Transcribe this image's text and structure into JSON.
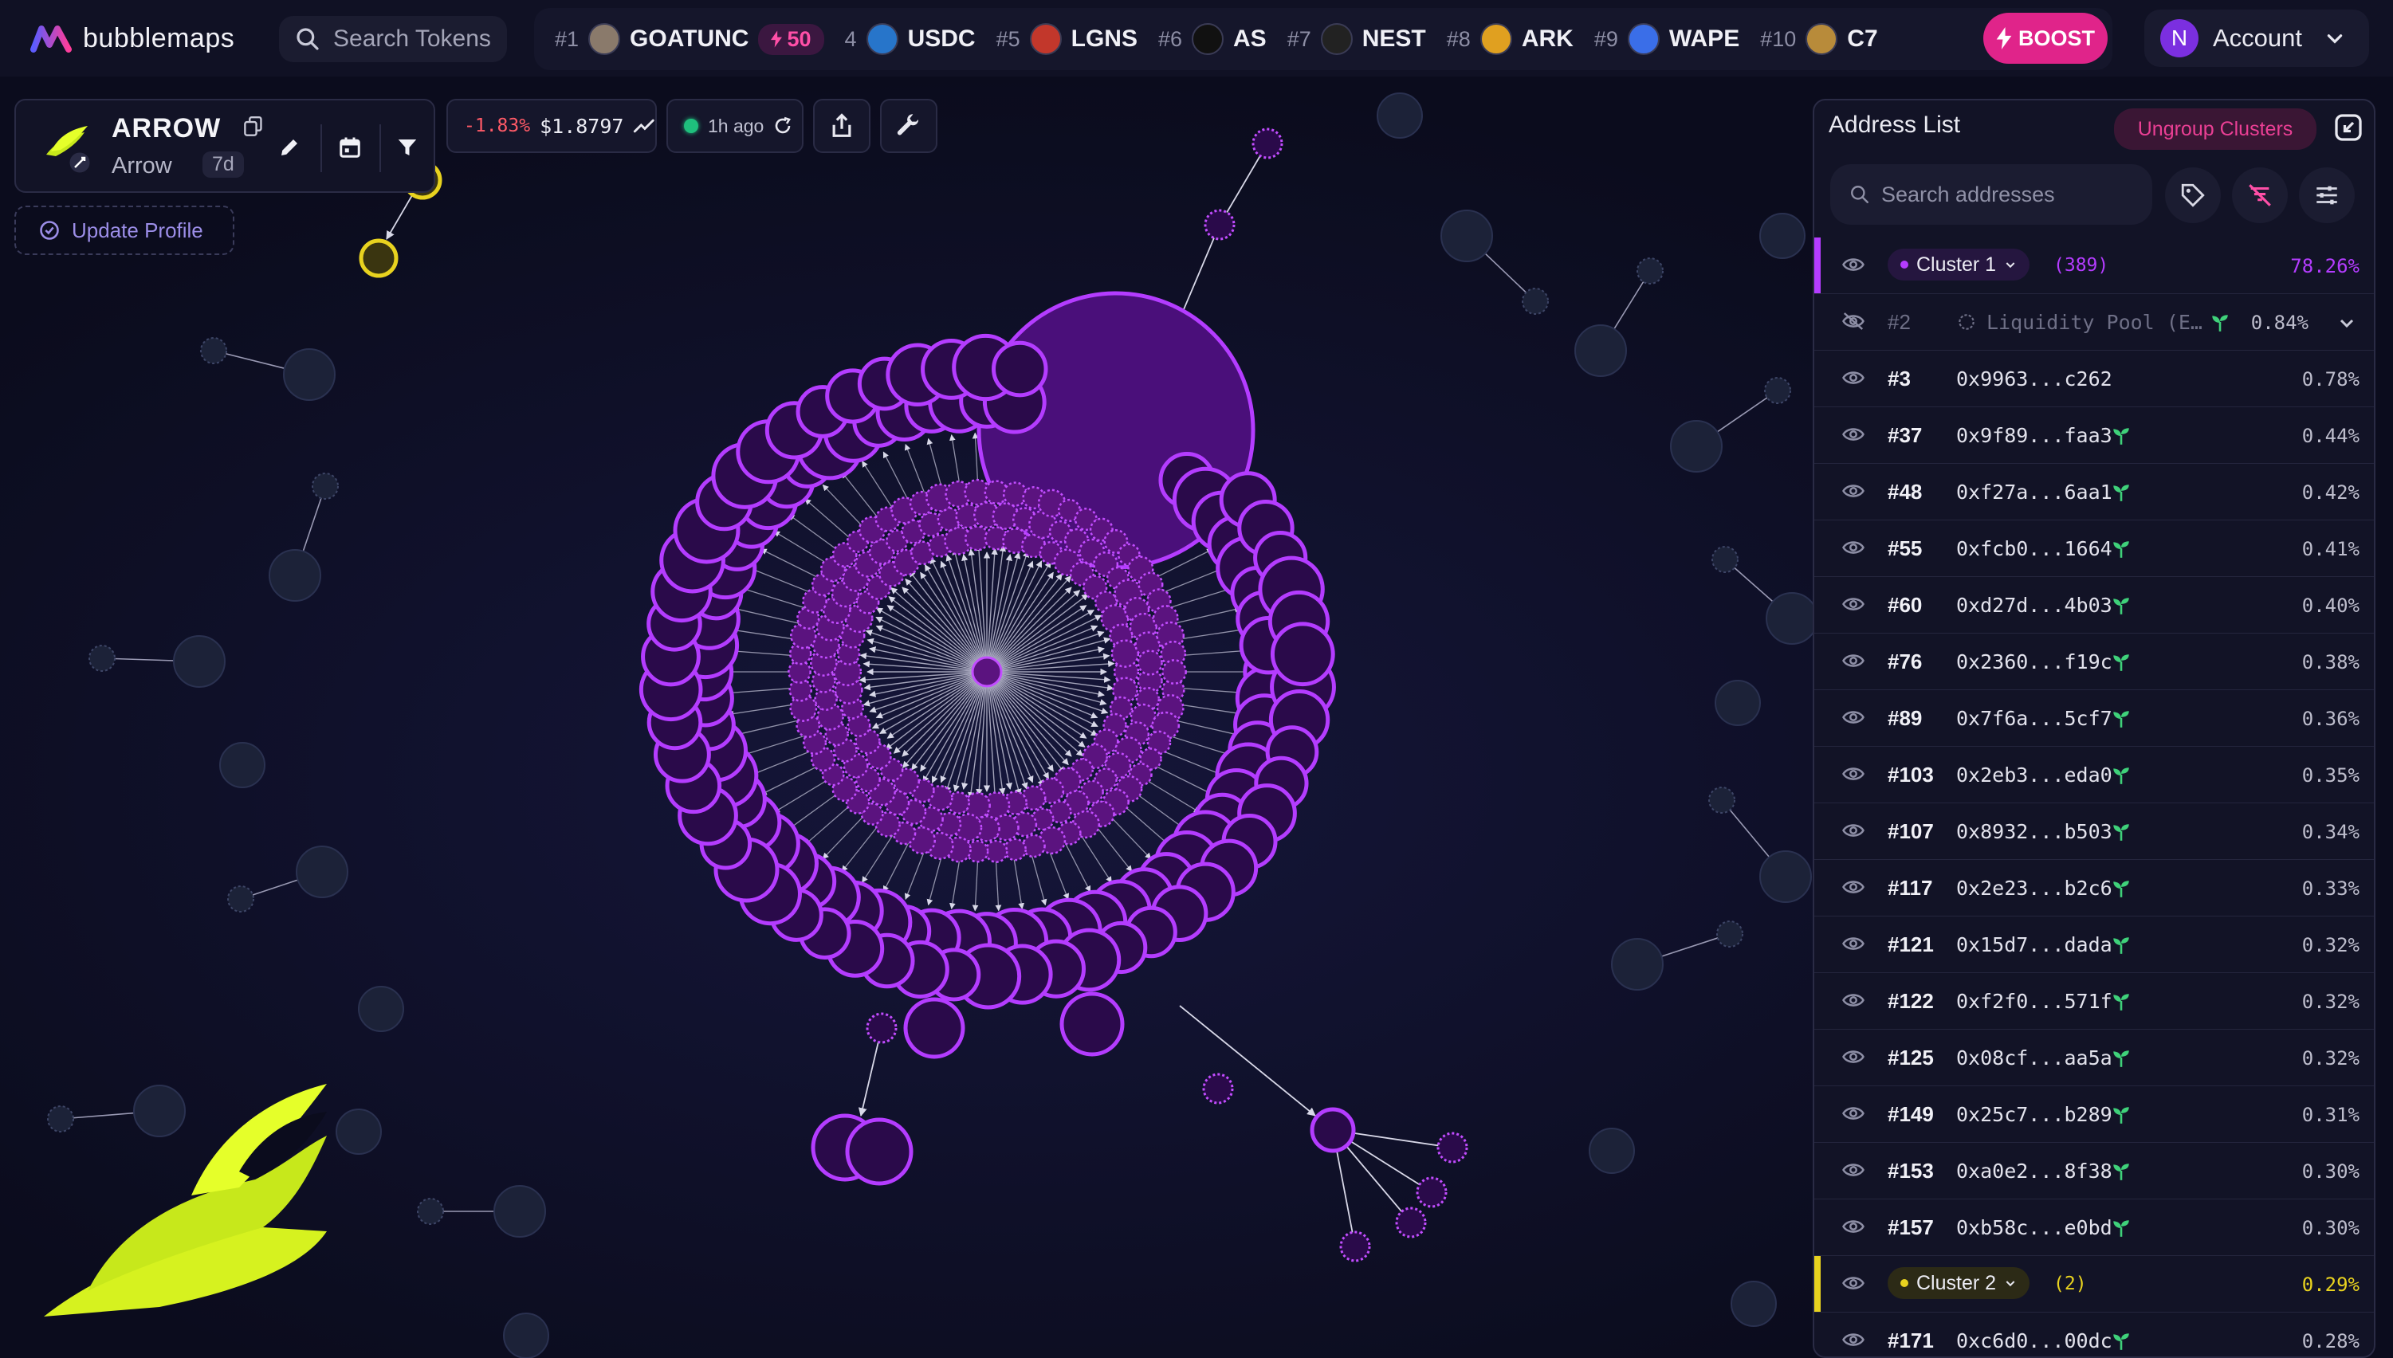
{
  "app": {
    "name": "bubblemaps"
  },
  "header": {
    "search_placeholder": "Search Tokens",
    "ticker": [
      {
        "rank": "#1",
        "symbol": "GOATUNC",
        "color": "#8a7a6b",
        "boost": "50"
      },
      {
        "rank": "4",
        "symbol": "USDC",
        "color": "#2775ca"
      },
      {
        "rank": "#5",
        "symbol": "LGNS",
        "color": "#c2372b"
      },
      {
        "rank": "#6",
        "symbol": "AS",
        "color": "#111111"
      },
      {
        "rank": "#7",
        "symbol": "NEST",
        "color": "#222222"
      },
      {
        "rank": "#8",
        "symbol": "ARK",
        "color": "#e0a020"
      },
      {
        "rank": "#9",
        "symbol": "WAPE",
        "color": "#3a6ee8"
      },
      {
        "rank": "#10",
        "symbol": "C7",
        "color": "#b88b3a"
      }
    ],
    "boost_label": "BOOST",
    "account_initial": "N",
    "account_label": "Account"
  },
  "token": {
    "symbol": "ARROW",
    "name": "Arrow",
    "age": "7d",
    "update_profile_label": "Update Profile",
    "price_change": "-1.83%",
    "price": "$1.8797",
    "updated": "1h ago"
  },
  "panel": {
    "title": "Address List",
    "ungroup_label": "Ungroup Clusters",
    "search_placeholder": "Search addresses",
    "rows": [
      {
        "type": "cluster",
        "label": "Cluster 1",
        "count": "(389)",
        "pct": "78.26%",
        "color": "#b43cff"
      },
      {
        "type": "pool",
        "rank": "#2",
        "label": "Liquidity Pool (E…",
        "pct": "0.84%"
      },
      {
        "type": "addr",
        "rank": "#3",
        "addr": "0x9963...c262",
        "pct": "0.78%",
        "leaf": false
      },
      {
        "type": "addr",
        "rank": "#37",
        "addr": "0x9f89...faa3",
        "pct": "0.44%",
        "leaf": true
      },
      {
        "type": "addr",
        "rank": "#48",
        "addr": "0xf27a...6aa1",
        "pct": "0.42%",
        "leaf": true
      },
      {
        "type": "addr",
        "rank": "#55",
        "addr": "0xfcb0...1664",
        "pct": "0.41%",
        "leaf": true
      },
      {
        "type": "addr",
        "rank": "#60",
        "addr": "0xd27d...4b03",
        "pct": "0.40%",
        "leaf": true
      },
      {
        "type": "addr",
        "rank": "#76",
        "addr": "0x2360...f19c",
        "pct": "0.38%",
        "leaf": true
      },
      {
        "type": "addr",
        "rank": "#89",
        "addr": "0x7f6a...5cf7",
        "pct": "0.36%",
        "leaf": true
      },
      {
        "type": "addr",
        "rank": "#103",
        "addr": "0x2eb3...eda0",
        "pct": "0.35%",
        "leaf": true
      },
      {
        "type": "addr",
        "rank": "#107",
        "addr": "0x8932...b503",
        "pct": "0.34%",
        "leaf": true
      },
      {
        "type": "addr",
        "rank": "#117",
        "addr": "0x2e23...b2c6",
        "pct": "0.33%",
        "leaf": true
      },
      {
        "type": "addr",
        "rank": "#121",
        "addr": "0x15d7...dada",
        "pct": "0.32%",
        "leaf": true
      },
      {
        "type": "addr",
        "rank": "#122",
        "addr": "0xf2f0...571f",
        "pct": "0.32%",
        "leaf": true
      },
      {
        "type": "addr",
        "rank": "#125",
        "addr": "0x08cf...aa5a",
        "pct": "0.32%",
        "leaf": true
      },
      {
        "type": "addr",
        "rank": "#149",
        "addr": "0x25c7...b289",
        "pct": "0.31%",
        "leaf": true
      },
      {
        "type": "addr",
        "rank": "#153",
        "addr": "0xa0e2...8f38",
        "pct": "0.30%",
        "leaf": true
      },
      {
        "type": "addr",
        "rank": "#157",
        "addr": "0xb58c...e0bd",
        "pct": "0.30%",
        "leaf": true
      },
      {
        "type": "cluster",
        "label": "Cluster 2",
        "count": "(2)",
        "pct": "0.29%",
        "color": "#e8d21f"
      },
      {
        "type": "addr",
        "rank": "#171",
        "addr": "0xc6d0...00dc",
        "pct": "0.28%",
        "leaf": true
      }
    ]
  },
  "colors": {
    "cluster_main": "#b43cff",
    "cluster_fill": "#4a0f7a",
    "cluster_2": "#e8d21f",
    "leaf": "#3fd17a",
    "accent_pink": "#e0248a"
  }
}
